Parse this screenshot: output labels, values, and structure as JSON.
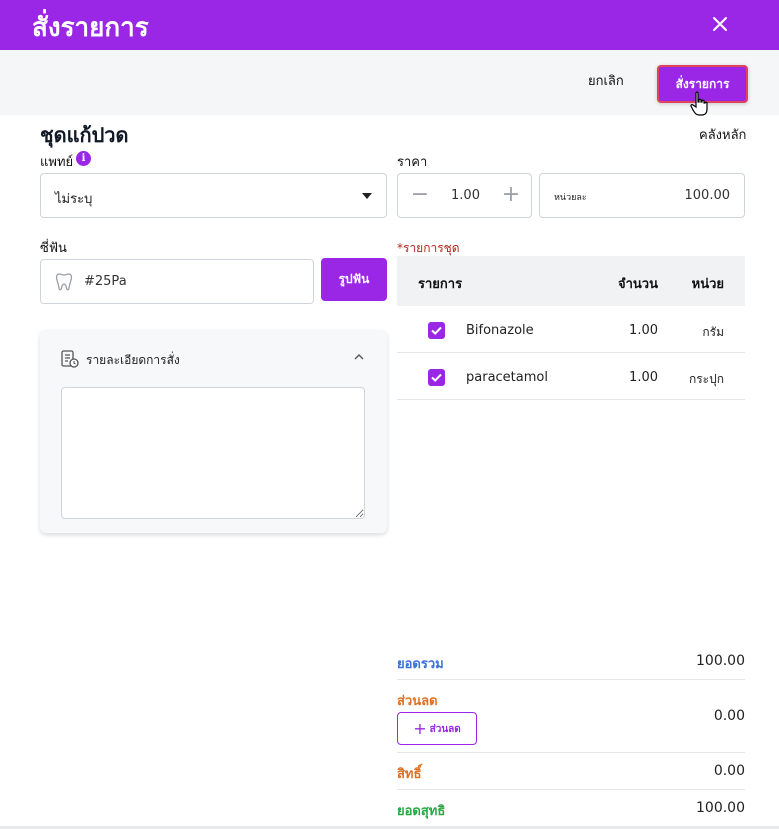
{
  "header": {
    "title": "สั่งรายการ"
  },
  "actions": {
    "cancel_label": "ยกเลิก",
    "order_label": "สั่งรายการ"
  },
  "set": {
    "name": "ชุดแก้ปวด",
    "warehouse": "คลังหลัก"
  },
  "doctor": {
    "label": "แพทย์",
    "value": "ไม่ระบุ"
  },
  "price": {
    "label": "ราคา",
    "quantity": "1.00",
    "unit_label": "หน่วยละ",
    "unit_price": "100.00"
  },
  "tooth": {
    "label": "ซี่ฟัน",
    "value": "#25Pa",
    "button_label": "รูปฟัน"
  },
  "order_detail": {
    "label": "รายละเอียดการสั่ง"
  },
  "items": {
    "label": "*รายการชุด",
    "headers": {
      "item": "รายการ",
      "qty": "จำนวน",
      "unit": "หน่วย"
    },
    "rows": [
      {
        "name": "Bifonazole",
        "qty": "1.00",
        "unit": "กรัม",
        "checked": true
      },
      {
        "name": "paracetamol",
        "qty": "1.00",
        "unit": "กระปุก",
        "checked": true
      }
    ]
  },
  "summary": {
    "total_label": "ยอดรวม",
    "total": "100.00",
    "discount_label": "ส่วนลด",
    "discount": "0.00",
    "discount_button": "ส่วนลด",
    "rights_label": "สิทธิ์",
    "rights": "0.00",
    "net_label": "ยอดสุทธิ",
    "net": "100.00"
  },
  "colors": {
    "primary": "#9b27e6",
    "required": "#b3261e",
    "total": "#3b6fd8",
    "discount": "#e07020",
    "rights": "#e07020",
    "net": "#28a745"
  }
}
